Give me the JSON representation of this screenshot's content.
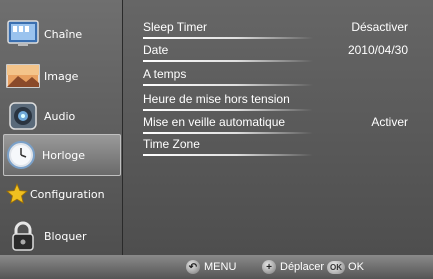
{
  "sidebar": {
    "items": [
      {
        "label": "Chaîne",
        "icon": "tv-channel-icon"
      },
      {
        "label": "Image",
        "icon": "picture-icon"
      },
      {
        "label": "Audio",
        "icon": "speaker-icon"
      },
      {
        "label": "Horloge",
        "icon": "clock-icon"
      },
      {
        "label": "Configuration",
        "icon": "star-icon"
      },
      {
        "label": "Bloquer",
        "icon": "lock-icon"
      }
    ],
    "active": "Horloge"
  },
  "menu": {
    "rows": [
      {
        "label": "Sleep Timer",
        "value": "Désactiver"
      },
      {
        "label": "Date",
        "value": "2010/04/30"
      },
      {
        "label": "A temps",
        "value": ""
      },
      {
        "label": "Heure de mise hors tension",
        "value": ""
      },
      {
        "label": "Mise en veille automatique",
        "value": "Activer"
      },
      {
        "label": "Time Zone",
        "value": ""
      }
    ]
  },
  "footer": {
    "menu_label": "MENU",
    "move_label": "Déplacer",
    "ok_badge": "OK",
    "ok_label": "OK"
  },
  "colors": {
    "text": "#ffffff",
    "panel": "#5a5a5a",
    "active_item": "#8a8a8a"
  }
}
